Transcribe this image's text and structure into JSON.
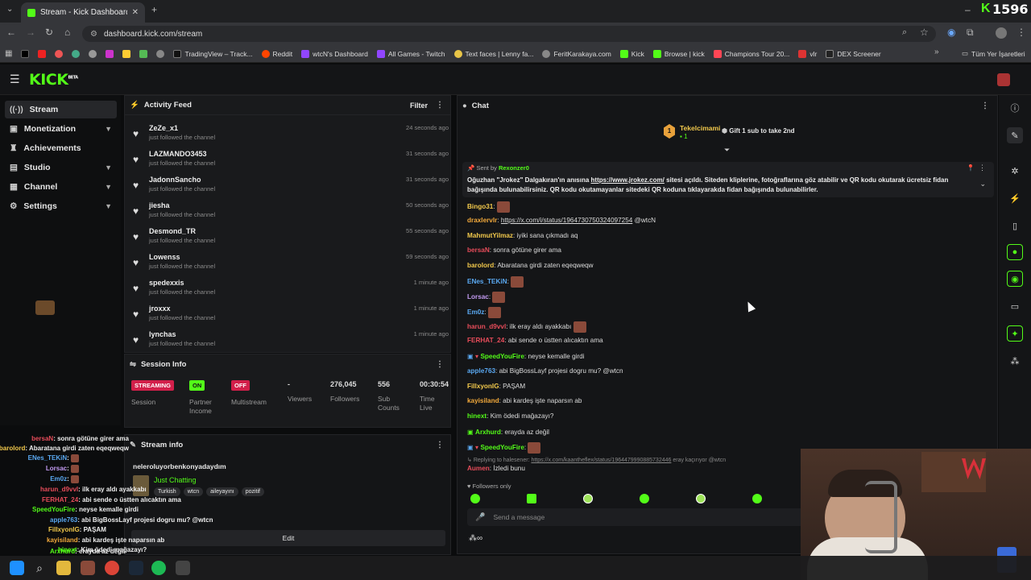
{
  "browser": {
    "tab_title": "Stream - Kick Dashboard",
    "url": "dashboard.kick.com/stream",
    "bookmarks": [
      "TradingView – Track...",
      "Reddit",
      "wtcN's Dashboard",
      "All Games - Twitch",
      "Text faces | Lenny fa...",
      "FeritKarakaya.com",
      "Kick",
      "Browse | kick",
      "Champions Tour 20...",
      "vlr",
      "DEX Screener"
    ],
    "all_bookmarks": "Tüm Yer İşaretleri",
    "overlay_counter": "1596"
  },
  "kick": {
    "logo": "KICK",
    "logo_sup": "BETA"
  },
  "sidebar": {
    "items": [
      {
        "label": "Stream",
        "icon": "stream-icon"
      },
      {
        "label": "Monetization",
        "icon": "dollar-icon"
      },
      {
        "label": "Achievements",
        "icon": "trophy-icon"
      },
      {
        "label": "Studio",
        "icon": "studio-icon"
      },
      {
        "label": "Channel",
        "icon": "channel-icon"
      },
      {
        "label": "Settings",
        "icon": "gear-icon"
      }
    ]
  },
  "activity": {
    "title": "Activity Feed",
    "filter": "Filter",
    "items": [
      {
        "name": "ZeZe_x1",
        "sub": "just followed the channel",
        "time": "24 seconds ago"
      },
      {
        "name": "LAZMANDO3453",
        "sub": "just followed the channel",
        "time": "31 seconds ago"
      },
      {
        "name": "JadonnSancho",
        "sub": "just followed the channel",
        "time": "31 seconds ago"
      },
      {
        "name": "jiesha",
        "sub": "just followed the channel",
        "time": "50 seconds ago"
      },
      {
        "name": "Desmond_TR",
        "sub": "just followed the channel",
        "time": "55 seconds ago"
      },
      {
        "name": "Lowenss",
        "sub": "just followed the channel",
        "time": "59 seconds ago"
      },
      {
        "name": "spedexxis",
        "sub": "just followed the channel",
        "time": "1 minute ago"
      },
      {
        "name": "jroxxx",
        "sub": "just followed the channel",
        "time": "1 minute ago"
      },
      {
        "name": "lynchas",
        "sub": "just followed the channel",
        "time": "1 minute ago"
      }
    ]
  },
  "session": {
    "title": "Session Info",
    "streaming": {
      "badge": "STREAMING",
      "label": "Session"
    },
    "partner": {
      "badge": "ON",
      "label": "Partner Income"
    },
    "multistream": {
      "badge": "OFF",
      "label": "Multistream"
    },
    "viewers": {
      "value": "-",
      "label": "Viewers"
    },
    "followers": {
      "value": "276,045",
      "label": "Followers"
    },
    "subs": {
      "value": "556",
      "label": "Sub Counts"
    },
    "time": {
      "value": "00:30:54",
      "label": "Time Live"
    }
  },
  "stream_info": {
    "title": "Stream info",
    "stream_title": "neleroluyorbenkonyadaydım",
    "category": "Just Chatting",
    "tags": [
      "Turkish",
      "wtcn",
      "aileyayını",
      "pozitif"
    ],
    "edit": "Edit"
  },
  "chat": {
    "title": "Chat",
    "gifter_name": "Tekelcimami",
    "gifter_count": "1",
    "gifter_rank": "1",
    "gift_text": "Gift 1 sub to take 2nd",
    "pinned_sender_label": "Sent by",
    "pinned_sender": "Rexonzer0",
    "pinned_text": "Oğuzhan \"Jrokez\" Dalgakıran'ın anısına",
    "pinned_link": "https://www.jrokez.com/",
    "pinned_text2": "sitesi açıldı. Siteden kliplerine, fotoğraflarına göz atabilir ve QR kodu okutarak ücretsiz",
    "pinned_text3": "fidan bağışında bulunabilirsiniz. QR kodu okutamayanlar sitedeki QR koduna tıklayarakda fidan bağışında bulunabilirler.",
    "messages": [
      {
        "user": "Bingo31",
        "color": "#f2c94c",
        "text": ""
      },
      {
        "user": "draxlervlr",
        "color": "#f2a93b",
        "text": "",
        "link": "https://x.com/i/status/1964730750324097254",
        "tail": " @wtcN"
      },
      {
        "user": "MahmutYilmaz",
        "color": "#f2c94c",
        "text": "iyiki sana çıkmadı aq"
      },
      {
        "user": "bersaN",
        "color": "#e74c5a",
        "text": "sonra götüne girer ama"
      },
      {
        "user": "barolord",
        "color": "#f2c94c",
        "text": "Abaratana girdi zaten eqeqweqw"
      },
      {
        "user": "ENes_TEKiN",
        "color": "#5aa9f2",
        "text": ""
      },
      {
        "user": "Lorsac",
        "color": "#c39bf2",
        "text": ""
      },
      {
        "user": "Em0z",
        "color": "#5aa9f2",
        "text": ""
      },
      {
        "user": "harun_d9vvl",
        "color": "#e74c5a",
        "text": "ilk eray aldı ayakkabı"
      },
      {
        "user": "FERHAT_24",
        "color": "#e74c5a",
        "text": "abi sende o üstten alıcaktın ama"
      },
      {
        "user": "SpeedYouFire",
        "color": "#53fc18",
        "text": "neyse kemalle girdi"
      },
      {
        "user": "apple763",
        "color": "#5aa9f2",
        "text": "abi BigBossLayf projesi dogru mu? @wtcn"
      },
      {
        "user": "FillxyonIG",
        "color": "#f2c94c",
        "text": "PAŞAM"
      },
      {
        "user": "kayisiland",
        "color": "#f2a93b",
        "text": "abi kardeş işte naparsın ab"
      },
      {
        "user": "hinext",
        "color": "#53fc18",
        "text": "Kim ödedi mağazayı?"
      },
      {
        "user": "Arxhurd",
        "color": "#53fc18",
        "text": "erayda az değil"
      },
      {
        "user": "SpeedYouFire",
        "color": "#53fc18",
        "text": ""
      }
    ],
    "reply_prefix": "Replying to halesener:",
    "reply_link": "https://x.com/kaantheflex/status/1964479990885732446",
    "reply_tail": " eray kaçırıyor @wtcn",
    "last_user": "Aumen",
    "last_text": "İzledi bunu",
    "followers_only": "Followers only",
    "input_placeholder": "Send a message"
  },
  "overlay_chat": [
    {
      "user": "bersaN",
      "text": "sonra götüne girer ama"
    },
    {
      "user": "barolord",
      "text": "Abaratana girdi zaten eqeqweqw"
    },
    {
      "user": "ENes_TEKiN",
      "text": ""
    },
    {
      "user": "Lorsac",
      "text": ""
    },
    {
      "user": "Em0z",
      "text": ""
    },
    {
      "user": "harun_d9vvl",
      "text": "ilk eray aldı ayakkabı"
    },
    {
      "user": "FERHAT_24",
      "text": "abi sende o üstten alıcaktın ama"
    },
    {
      "user": "SpeedYouFire",
      "text": "neyse kemalle girdi"
    },
    {
      "user": "apple763",
      "text": "abi BigBossLayf projesi dogru mu? @wtcn"
    },
    {
      "user": "FillxyonIG",
      "text": "PAŞAM"
    },
    {
      "user": "kayisiland",
      "text": "abi kardeş işte naparsın ab"
    },
    {
      "user": "hinext",
      "text": "Kim ödedi mağazayı?"
    },
    {
      "user": "Arxhurd",
      "text": "erayda az değil"
    }
  ]
}
